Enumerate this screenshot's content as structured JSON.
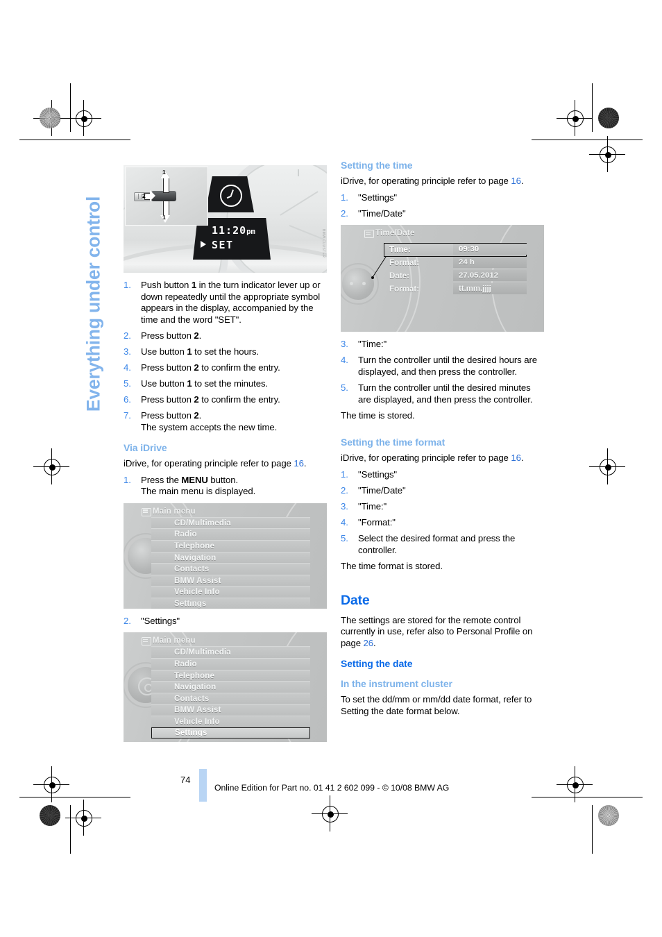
{
  "running_head": "Everything under control",
  "left_column": {
    "figure_cluster": {
      "name": "instrument-cluster-clock-set",
      "lcd_time": "11:20",
      "lcd_ampm": "pm",
      "lcd_set": "SET",
      "callout_1": "1",
      "callout_1b": "1",
      "callout_2": "2",
      "clock_icon": "clock-icon"
    },
    "steps_cluster": [
      {
        "num": "1.",
        "text_parts": [
          "Push button ",
          "1",
          " in the turn indicator lever up or down repeatedly until the appropriate symbol appears in the display, accompanied by the time and the word \"SET\"."
        ]
      },
      {
        "num": "2.",
        "text_parts": [
          "Press button ",
          "2",
          "."
        ]
      },
      {
        "num": "3.",
        "text_parts": [
          "Use button ",
          "1",
          " to set the hours."
        ]
      },
      {
        "num": "4.",
        "text_parts": [
          "Press button ",
          "2",
          " to confirm the entry."
        ]
      },
      {
        "num": "5.",
        "text_parts": [
          "Use button ",
          "1",
          " to set the minutes."
        ]
      },
      {
        "num": "6.",
        "text_parts": [
          "Press button ",
          "2",
          " to confirm the entry."
        ]
      },
      {
        "num": "7.",
        "text_parts": [
          "Press button ",
          "2",
          ".\nThe system accepts the new time."
        ]
      }
    ],
    "via_idrive": {
      "heading": "Via iDrive",
      "intro_a": "iDrive, for operating principle refer to page ",
      "intro_page": "16",
      "intro_b": ".",
      "step1_num": "1.",
      "step1_a": "Press the ",
      "step1_bold": "MENU",
      "step1_b": " button.",
      "step1_line2": "The main menu is displayed.",
      "step2_num": "2.",
      "step2_text": "\"Settings\""
    },
    "main_menu_screen": {
      "title": "Main menu",
      "title_icon": "menu-icon",
      "items": [
        "CD/Multimedia",
        "Radio",
        "Telephone",
        "Navigation",
        "Contacts",
        "BMW Assist",
        "Vehicle Info",
        "Settings"
      ],
      "selected": "Settings",
      "knob_icon": "controller-knob-icon",
      "gear_icon": "settings-gear-icon"
    }
  },
  "right_column": {
    "setting_the_time": {
      "heading": "Setting the time",
      "intro_a": "iDrive, for operating principle refer to page ",
      "intro_page": "16",
      "intro_b": ".",
      "steps_before": [
        {
          "num": "1.",
          "text": "\"Settings\""
        },
        {
          "num": "2.",
          "text": "\"Time/Date\""
        }
      ],
      "steps_after": [
        {
          "num": "3.",
          "text": "\"Time:\""
        },
        {
          "num": "4.",
          "text": "Turn the controller until the desired hours are displayed, and then press the controller."
        },
        {
          "num": "5.",
          "text": "Turn the controller until the desired minutes are displayed, and then press the controller."
        }
      ],
      "closing": "The time is stored."
    },
    "time_date_screen": {
      "title": "Time/Date",
      "title_icon": "clock-settings-icon",
      "rows": [
        {
          "label": "Time:",
          "value": "09:30",
          "selected": true
        },
        {
          "label": "Format:",
          "value": "24 h",
          "selected": false
        },
        {
          "label": "Date:",
          "value": "27.05.2012",
          "selected": false
        },
        {
          "label": "Format:",
          "value": "tt.mm.jjjj",
          "selected": false
        }
      ],
      "knob_icon": "controller-knob-icon"
    },
    "setting_the_time_format": {
      "heading": "Setting the time format",
      "intro_a": "iDrive, for operating principle refer to page ",
      "intro_page": "16",
      "intro_b": ".",
      "steps": [
        {
          "num": "1.",
          "text": "\"Settings\""
        },
        {
          "num": "2.",
          "text": "\"Time/Date\""
        },
        {
          "num": "3.",
          "text": "\"Time:\""
        },
        {
          "num": "4.",
          "text": "\"Format:\""
        },
        {
          "num": "5.",
          "text": "Select the desired format and press the controller."
        }
      ],
      "closing": "The time format is stored."
    },
    "date_section": {
      "heading": "Date",
      "body_a": "The settings are stored for the remote control currently in use, refer also to Personal Profile on page ",
      "body_page": "26",
      "body_b": ".",
      "setting_the_date": "Setting the date",
      "in_cluster_heading": "In the instrument cluster",
      "in_cluster_body": "To set the dd/mm or mm/dd date format, refer to Setting the date format below."
    }
  },
  "footer": {
    "page_number": "74",
    "imprint": "Online Edition for Part no. 01 41 2 602 099 - © 10/08 BMW AG"
  },
  "colors": {
    "heading_strong_blue": "#0a6ae8",
    "heading_light_blue": "#7cb2ea",
    "running_head_blue": "#82b4ec",
    "step_number_blue": "#3b86e8",
    "page_ref_blue": "#2b6fd6",
    "footer_bar_blue": "#b9d5f4"
  }
}
